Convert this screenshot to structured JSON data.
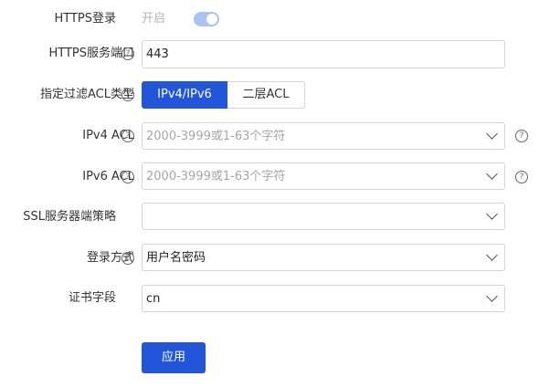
{
  "https_login": {
    "label": "HTTPS登录",
    "toggle_text": "开启",
    "enabled": true
  },
  "https_port": {
    "label": "HTTPS服务端口",
    "value": "443"
  },
  "acl_type": {
    "label": "指定过滤ACL类型",
    "options": [
      "IPv4/IPv6",
      "二层ACL"
    ],
    "selected": "IPv4/IPv6"
  },
  "ipv4_acl": {
    "label": "IPv4 ACL",
    "placeholder": "2000-3999或1-63个字符",
    "value": ""
  },
  "ipv6_acl": {
    "label": "IPv6 ACL",
    "placeholder": "2000-3999或1-63个字符",
    "value": ""
  },
  "ssl_policy": {
    "label": "SSL服务器端策略",
    "value": ""
  },
  "login_method": {
    "label": "登录方式",
    "value": "用户名密码"
  },
  "cert_field": {
    "label": "证书字段",
    "value": "cn"
  },
  "apply_label": "应用",
  "help_glyph": "?",
  "colors": {
    "primary": "#2255d8",
    "toggle_on": "#a9c3f2",
    "border": "#d5d5d5",
    "placeholder": "#a6a6a6"
  }
}
